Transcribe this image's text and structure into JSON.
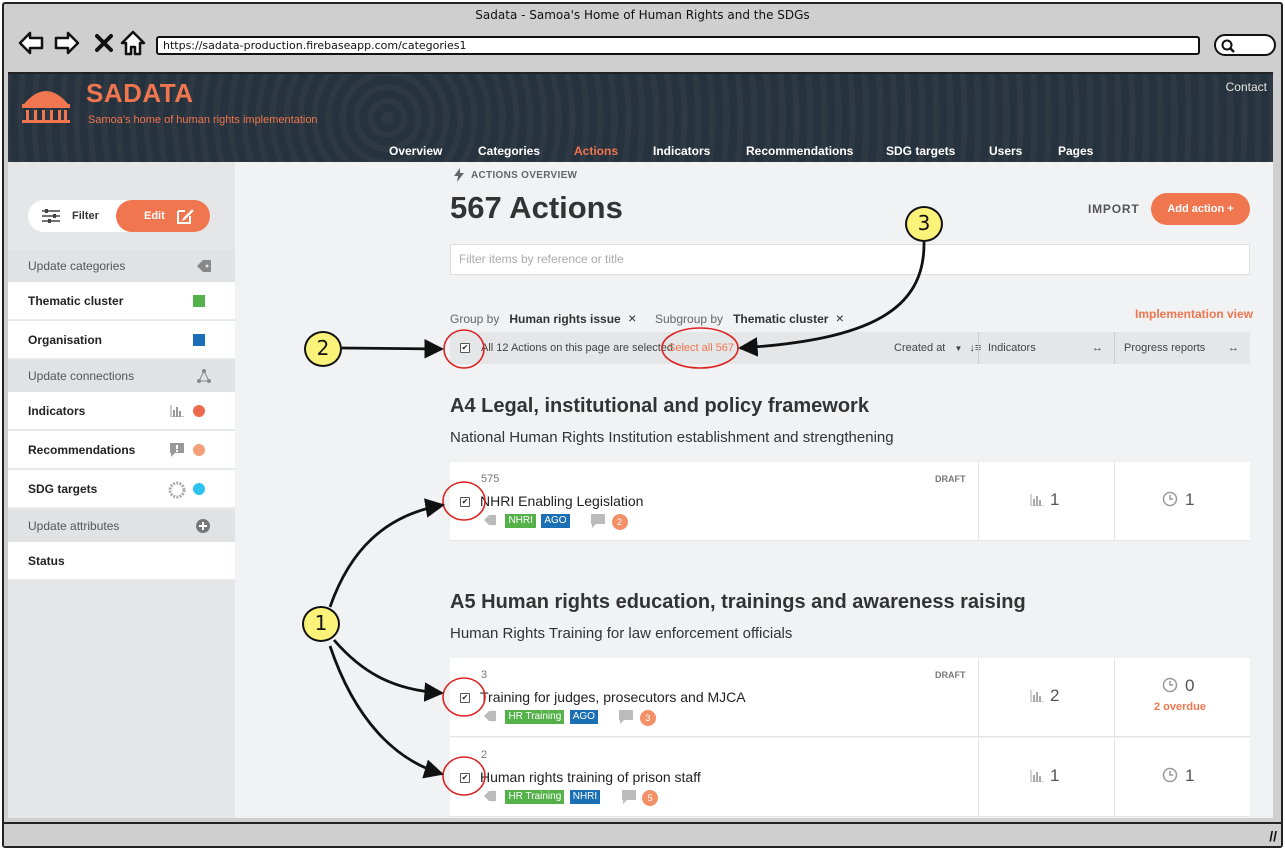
{
  "browser": {
    "title": "Sadata - Samoa's Home of Human Rights and the SDGs",
    "url": "https://sadata-production.firebaseapp.com/categories1"
  },
  "header": {
    "brand": "SADATA",
    "tagline": "Samoa's home of human rights implementation",
    "contact": "Contact",
    "nav": [
      "Overview",
      "Categories",
      "Actions",
      "Indicators",
      "Recommendations",
      "SDG targets",
      "Users",
      "Pages"
    ],
    "active_nav": "Actions",
    "colors": {
      "accent": "#f0764f",
      "header_bg": "#26323d"
    }
  },
  "sidebar": {
    "filter_label": "Filter",
    "edit_label": "Edit",
    "sections": [
      {
        "title": "Update categories",
        "icon": "tag-icon"
      },
      {
        "title": "Update connections",
        "icon": "network-icon"
      },
      {
        "title": "Update attributes",
        "icon": "plus-circle-icon"
      }
    ],
    "items": [
      {
        "label": "Thematic cluster",
        "color": "#55b24a"
      },
      {
        "label": "Organisation",
        "color": "#1a6fb5"
      },
      {
        "label": "Indicators",
        "color": "#ee6a4f",
        "icon": "bar-chart-icon"
      },
      {
        "label": "Recommendations",
        "color": "#f4a07a",
        "icon": "comment-icon"
      },
      {
        "label": "SDG targets",
        "color": "#2cc4ef",
        "icon": "sdg-wheel-icon"
      },
      {
        "label": "Status"
      }
    ]
  },
  "main": {
    "overview_label": "ACTIONS OVERVIEW",
    "title": "567 Actions",
    "import_label": "IMPORT",
    "add_label": "Add action +",
    "search_placeholder": "Filter items by reference or title",
    "group_by_label": "Group by",
    "group_by_value": "Human rights issue",
    "subgroup_by_label": "Subgroup by",
    "subgroup_by_value": "Thematic cluster",
    "implementation_view": "Implementation view",
    "list_header": {
      "selected_text": "All 12 Actions on this page are selected",
      "select_all": "Select all 567",
      "sort_label": "Created at",
      "col_indicators": "Indicators",
      "col_progress": "Progress reports"
    },
    "groups": [
      {
        "title": "A4 Legal, institutional and policy framework",
        "subgroup": "National Human Rights Institution establishment and strengthening",
        "rows": [
          {
            "ref": "575",
            "title": "NHRI Enabling Legislation",
            "status": "DRAFT",
            "tags": [
              {
                "label": "NHRI",
                "color": "#55b24a"
              },
              {
                "label": "AGO",
                "color": "#1a6fb5"
              }
            ],
            "recommendations": "2",
            "indicators": "1",
            "progress": "1",
            "overdue": ""
          }
        ]
      },
      {
        "title": "A5 Human rights education, trainings and awareness raising",
        "subgroup": "Human Rights Training for law enforcement officials",
        "rows": [
          {
            "ref": "3",
            "title": "Training for judges, prosecutors and MJCA",
            "status": "DRAFT",
            "tags": [
              {
                "label": "HR Training",
                "color": "#55b24a"
              },
              {
                "label": "AGO",
                "color": "#1a6fb5"
              }
            ],
            "recommendations": "3",
            "indicators": "2",
            "progress": "0",
            "overdue": "2 overdue"
          },
          {
            "ref": "2",
            "title": "Human rights training of prison staff",
            "status": "",
            "tags": [
              {
                "label": "HR Training",
                "color": "#55b24a"
              },
              {
                "label": "NHRI",
                "color": "#1a6fb5"
              }
            ],
            "recommendations": "5",
            "indicators": "1",
            "progress": "1",
            "overdue": ""
          }
        ]
      }
    ]
  },
  "annotations": [
    "1",
    "2",
    "3"
  ]
}
